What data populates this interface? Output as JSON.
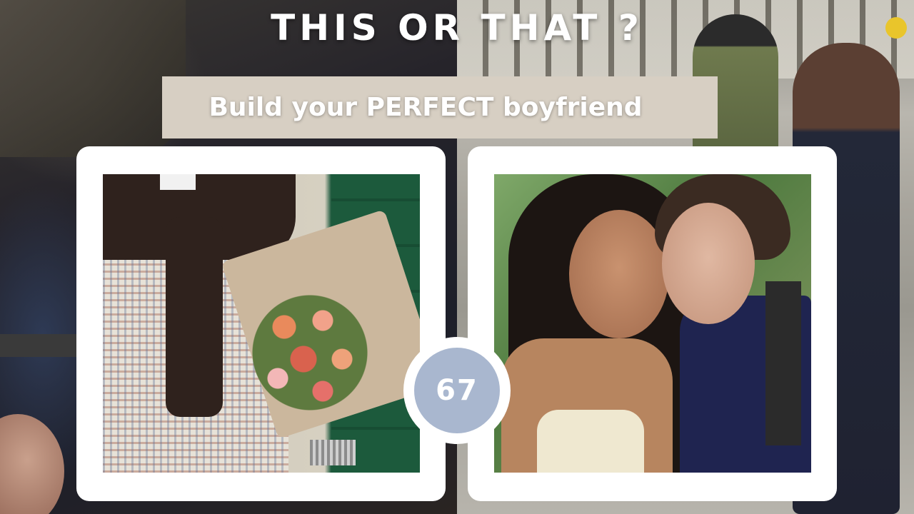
{
  "title": "THIS OR THAT ?",
  "subtitle": "Build your PERFECT boyfriend",
  "counter": "67",
  "colors": {
    "title_text": "#ffffff",
    "subtitle_bar": "#d7cfc3",
    "counter_fill": "#a9b7cf",
    "card_frame": "#ffffff"
  },
  "options": [
    {
      "side": "left",
      "image": "flannel-shirt-with-flower-bouquet"
    },
    {
      "side": "right",
      "image": "couple-cheek-kiss-selfie"
    }
  ]
}
